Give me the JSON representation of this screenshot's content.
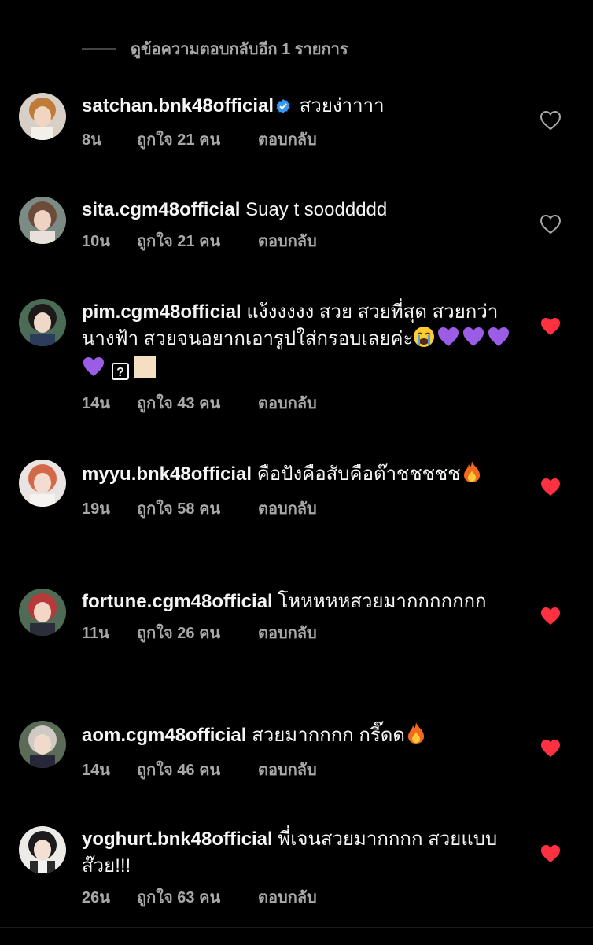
{
  "view_more": "ดูข้อความตอบกลับอีก 1 รายการ",
  "comments": [
    {
      "username": "satchan.bnk48official",
      "verified": true,
      "text": "สวยง่าาาา",
      "time": "8น",
      "likes": "ถูกใจ 21 คน",
      "reply": "ตอบกลับ",
      "liked": false
    },
    {
      "username": "sita.cgm48official",
      "text": "Suay t sooddddd",
      "time": "10น",
      "likes": "ถูกใจ 21 คน",
      "reply": "ตอบกลับ",
      "liked": false
    },
    {
      "username": "pim.cgm48official",
      "text": "แง้งงงงง สวย สวยที่สุด สวยกว่านางฟ้า สวยจนอยากเอารูปใส่กรอบเลยค่ะ",
      "emoji_note": "crying-face, purple-heart x4, unknown-glyph, skin-tone-swatch",
      "question_glyph": "?",
      "time": "14น",
      "likes": "ถูกใจ 43 คน",
      "reply": "ตอบกลับ",
      "liked": true
    },
    {
      "username": "myyu.bnk48official",
      "text": "คือปังคือสับคือต๊าชชชชช",
      "time": "19น",
      "likes": "ถูกใจ 58 คน",
      "reply": "ตอบกลับ",
      "liked": true
    },
    {
      "username": "fortune.cgm48official",
      "text": "โหหหหหสวยมากกกกกกก",
      "time": "11น",
      "likes": "ถูกใจ 26 คน",
      "reply": "ตอบกลับ",
      "liked": true
    },
    {
      "username": "aom.cgm48official",
      "text": "สวยมากกกก กรี๊ดด",
      "time": "14น",
      "likes": "ถูกใจ 46 คน",
      "reply": "ตอบกลับ",
      "liked": true
    },
    {
      "username": "yoghurt.bnk48official",
      "text": "พี่เจนสวยมากกกก สวยแบบส๊วย!!!",
      "time": "26น",
      "likes": "ถูกใจ 63 คน",
      "reply": "ตอบกลับ",
      "liked": true
    }
  ],
  "colors": {
    "background": "#000000",
    "text": "#f5f5f5",
    "muted": "#a8a8a8",
    "heart_liked": "#ff3040",
    "verified": "#3897f0"
  },
  "icons": [
    "verified-badge-icon",
    "heart-outline-icon",
    "heart-filled-icon",
    "loudly-crying-face-emoji",
    "purple-heart-emoji",
    "fire-emoji"
  ]
}
